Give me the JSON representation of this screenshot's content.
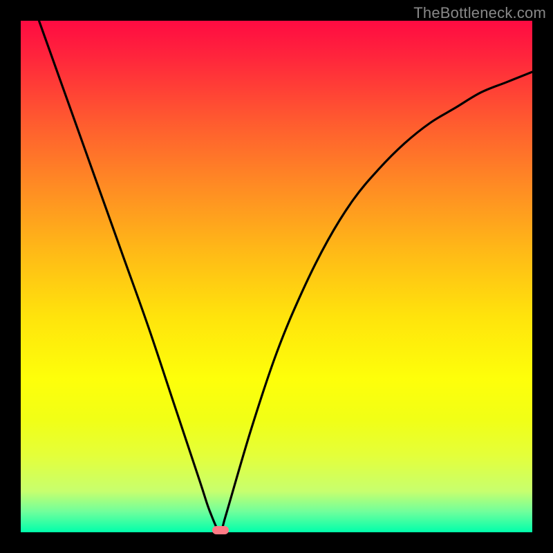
{
  "watermark": "TheBottleneck.com",
  "chart_data": {
    "type": "line",
    "title": "",
    "xlabel": "",
    "ylabel": "",
    "xlim": [
      0,
      100
    ],
    "ylim": [
      0,
      100
    ],
    "grid": false,
    "legend": false,
    "series": [
      {
        "name": "bottleneck-curve",
        "x": [
          0,
          5,
          10,
          15,
          20,
          25,
          30,
          35,
          37,
          39,
          40,
          45,
          50,
          55,
          60,
          65,
          70,
          75,
          80,
          85,
          90,
          95,
          100
        ],
        "values": [
          110,
          96,
          82,
          68,
          54,
          40,
          25,
          10,
          4,
          0,
          3,
          20,
          35,
          47,
          57,
          65,
          71,
          76,
          80,
          83,
          86,
          88,
          90
        ]
      }
    ],
    "annotations": [
      {
        "name": "valley-marker",
        "x": 39,
        "y": 0
      }
    ]
  },
  "colors": {
    "curve": "#000000",
    "marker": "#ff7a85",
    "frame_bg_top": "#ff0b42",
    "frame_bg_bottom": "#00ffab",
    "page_bg": "#000000"
  }
}
